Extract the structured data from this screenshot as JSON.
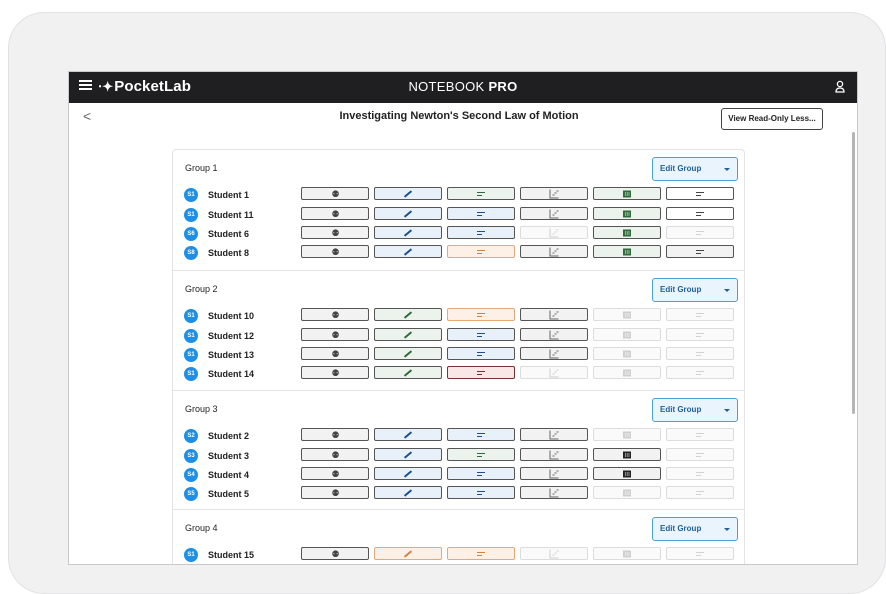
{
  "app": {
    "logo_mark": "⋅✦",
    "logo": "PocketLab",
    "title_prefix": "NOTEBOOK ",
    "title_bold": "PRO"
  },
  "lesson": {
    "back": "<",
    "title": "Investigating Newton's Second Law of Motion",
    "readonly_label": "View Read-Only Less..."
  },
  "colors": {
    "badge": "#1d8fe6",
    "pencil_blue": "#1d4f8c",
    "pencil_green": "#2f6b3a",
    "pencil_orange": "#d2823f",
    "table_green": "#2f6b3a",
    "edit_border": "#4a9fd8"
  },
  "icons": [
    "people-icon",
    "pencil-icon",
    "text-lines-icon",
    "graph-icon",
    "table-icon",
    "text-lines-icon"
  ],
  "groups": [
    {
      "name": "Group 1",
      "edit_label": "Edit Group",
      "students": [
        {
          "badge": "S1",
          "name": "Student 1",
          "cells": [
            "gray",
            "blue",
            "green",
            "gray",
            "green",
            "dim"
          ]
        },
        {
          "badge": "S1",
          "name": "Student 11",
          "cells": [
            "gray",
            "blue",
            "blue",
            "gray",
            "green",
            "dim"
          ]
        },
        {
          "badge": "S6",
          "name": "Student 6",
          "cells": [
            "gray",
            "blue",
            "blue",
            "faded",
            "green",
            "faded"
          ]
        },
        {
          "badge": "S8",
          "name": "Student 8",
          "cells": [
            "gray",
            "blue",
            "orange",
            "gray",
            "green",
            "gray"
          ]
        }
      ]
    },
    {
      "name": "Group 2",
      "edit_label": "Edit Group",
      "students": [
        {
          "badge": "S1",
          "name": "Student 10",
          "cells": [
            "gray",
            "green",
            "orange",
            "gray",
            "faded",
            "faded"
          ]
        },
        {
          "badge": "S1",
          "name": "Student 12",
          "cells": [
            "gray",
            "green",
            "blue",
            "gray",
            "faded",
            "faded"
          ]
        },
        {
          "badge": "S1",
          "name": "Student 13",
          "cells": [
            "gray",
            "green",
            "blue",
            "gray",
            "faded",
            "faded"
          ]
        },
        {
          "badge": "S1",
          "name": "Student 14",
          "cells": [
            "gray",
            "green",
            "pink",
            "faded",
            "faded",
            "faded"
          ]
        }
      ]
    },
    {
      "name": "Group 3",
      "edit_label": "Edit Group",
      "students": [
        {
          "badge": "S2",
          "name": "Student 2",
          "cells": [
            "gray",
            "blue",
            "blue",
            "gray",
            "faded",
            "faded"
          ]
        },
        {
          "badge": "S3",
          "name": "Student 3",
          "cells": [
            "gray",
            "blue",
            "green",
            "gray",
            "gray",
            "faded"
          ]
        },
        {
          "badge": "S4",
          "name": "Student 4",
          "cells": [
            "gray",
            "blue",
            "blue",
            "gray",
            "gray",
            "faded"
          ]
        },
        {
          "badge": "S5",
          "name": "Student 5",
          "cells": [
            "gray",
            "blue",
            "blue",
            "gray",
            "faded",
            "faded"
          ]
        }
      ]
    },
    {
      "name": "Group 4",
      "edit_label": "Edit Group",
      "students": [
        {
          "badge": "S1",
          "name": "Student 15",
          "cells": [
            "gray",
            "orange",
            "orange",
            "faded",
            "faded",
            "faded"
          ]
        }
      ]
    }
  ]
}
